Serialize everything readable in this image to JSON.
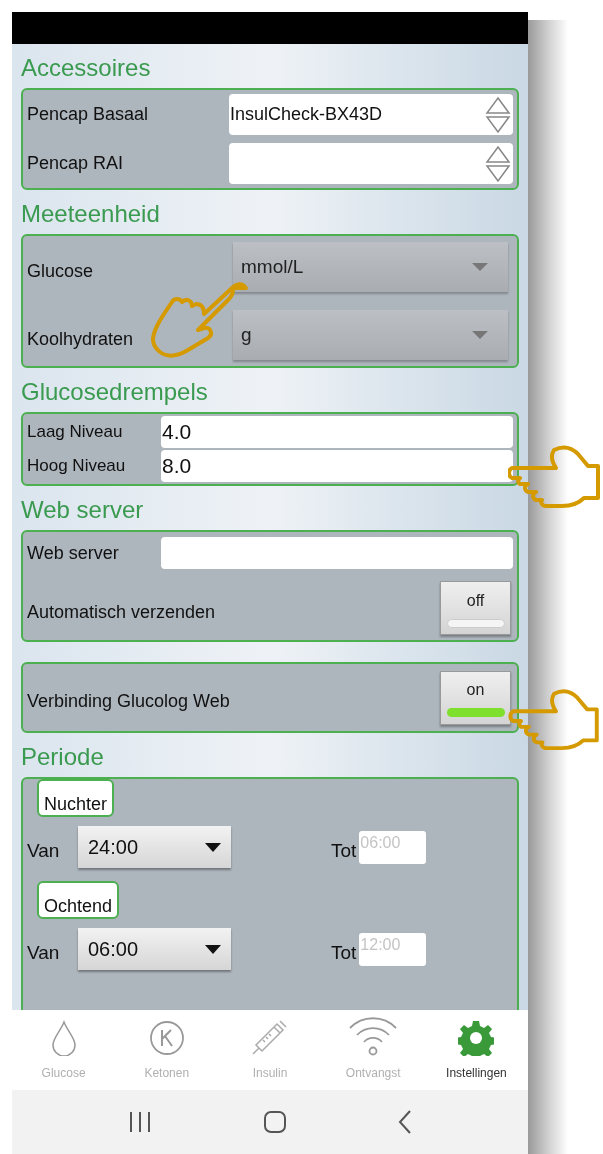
{
  "sections": [
    {
      "kind": "spinners",
      "title": "Accessoires",
      "rows": [
        {
          "label": "Pencap Basaal",
          "value": "InsulCheck-BX43D"
        },
        {
          "label": "Pencap RAI",
          "value": ""
        }
      ]
    },
    {
      "kind": "dropdowns",
      "title": "Meeteenheid",
      "rows": [
        {
          "label": "Glucose",
          "value": "mmol/L"
        },
        {
          "label": "Koolhydraten",
          "value": "g"
        }
      ]
    },
    {
      "kind": "inputs",
      "title": "Glucosedrempels",
      "rows": [
        {
          "label": "Laag Niveau",
          "value": "4.0"
        },
        {
          "label": "Hoog Niveau",
          "value": "8.0"
        }
      ]
    },
    {
      "kind": "server",
      "title": "Web server",
      "rows": [
        {
          "kind": "input",
          "label": "Web server",
          "value": ""
        },
        {
          "kind": "toggle",
          "label": "Automatisch verzenden",
          "text": "off",
          "on": false
        }
      ]
    },
    {
      "kind": "server",
      "rows": [
        {
          "kind": "toggle",
          "label": "Verbinding Glucolog Web",
          "text": "on",
          "on": true
        }
      ]
    },
    {
      "kind": "periods",
      "title": "Periode",
      "periods": [
        {
          "name": "Nuchter",
          "from_label": "Van",
          "from": "24:00",
          "to_label": "Tot",
          "to": "06:00",
          "to_disabled": true
        },
        {
          "name": "Ochtend",
          "from_label": "Van",
          "from": "06:00",
          "to_label": "Tot",
          "to": "12:00",
          "to_disabled": true
        }
      ]
    }
  ],
  "bottom_nav": [
    {
      "kind": "drop",
      "label": "Glucose",
      "selected": false
    },
    {
      "kind": "k",
      "label": "Ketonen",
      "selected": false
    },
    {
      "kind": "syringe",
      "label": "Insulin",
      "selected": false
    },
    {
      "kind": "wifi",
      "label": "Ontvangst",
      "selected": false
    },
    {
      "kind": "gear",
      "label": "Instellingen",
      "selected": true
    }
  ]
}
